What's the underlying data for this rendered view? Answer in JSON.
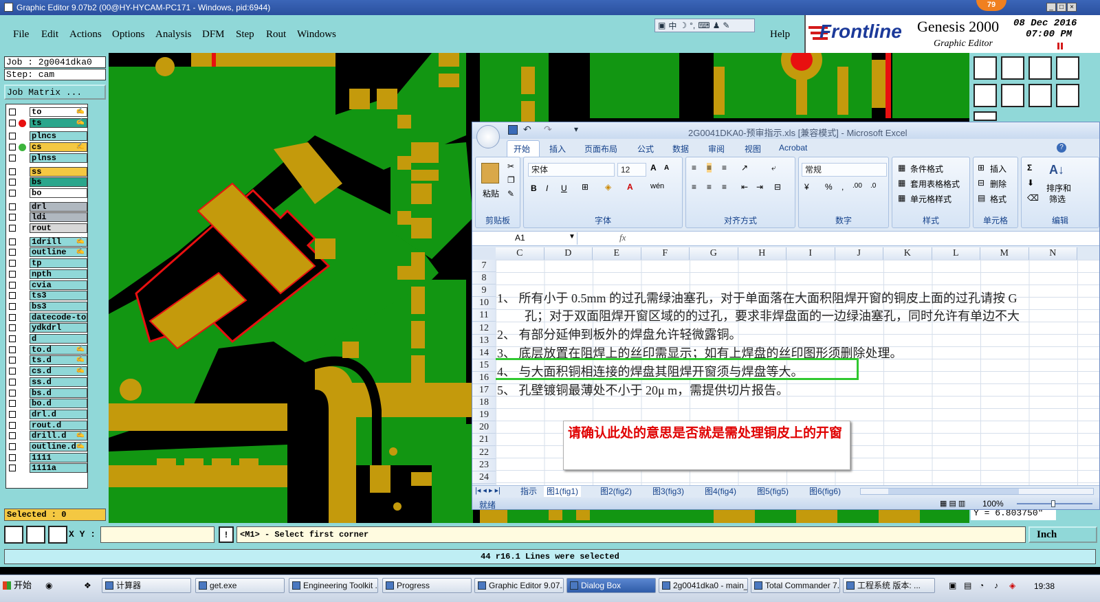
{
  "window": {
    "title": "Graphic Editor 9.07b2 (00@HY-HYCAM-PC171 - Windows, pid:6944)"
  },
  "menubar": {
    "items": [
      "File",
      "Edit",
      "Actions",
      "Options",
      "Analysis",
      "DFM",
      "Step",
      "Rout",
      "Windows"
    ],
    "help": "Help",
    "toolbar_icons": [
      "input-method-icon",
      "chinese-mode-icon",
      "moon-icon",
      "punctuation-icon",
      "keyboard-icon",
      "user-icon",
      "wrench-icon"
    ],
    "ime_label": "中"
  },
  "brand": {
    "logo": "Frontline",
    "product": "Genesis 2000",
    "subtitle": "Graphic Editor",
    "date": "08 Dec 2016",
    "time": "07:00 PM",
    "badge": "79"
  },
  "job": {
    "job": "Job : 2g0041dka0",
    "step": "Step: cam",
    "matrix_button": "Job Matrix ..."
  },
  "layers": [
    {
      "name": "to",
      "bg": "#ffffff",
      "dot": "",
      "mark": true
    },
    {
      "name": "ts",
      "bg": "#2aa68c",
      "dot": "#e81010",
      "mark": true
    },
    {
      "name": "plncs",
      "bg": "#90d8d8",
      "dot": "",
      "mark": false
    },
    {
      "name": "cs",
      "bg": "#f4c842",
      "dot": "#3cb43c",
      "mark": true
    },
    {
      "name": "plnss",
      "bg": "#90d8d8",
      "dot": "",
      "mark": false
    },
    {
      "name": "ss",
      "bg": "#f4c842",
      "dot": "",
      "mark": false
    },
    {
      "name": "bs",
      "bg": "#2aa68c",
      "dot": "",
      "mark": false
    },
    {
      "name": "bo",
      "bg": "#ffffff",
      "dot": "",
      "mark": false
    },
    {
      "name": "drl",
      "bg": "#b0b8c0",
      "dot": "",
      "mark": false
    },
    {
      "name": "ldi",
      "bg": "#b0b8c0",
      "dot": "",
      "mark": false
    },
    {
      "name": "rout",
      "bg": "#d8d8d8",
      "dot": "",
      "mark": false
    },
    {
      "name": "1drill",
      "bg": "#90d8d8",
      "dot": "",
      "mark": true
    },
    {
      "name": "outline",
      "bg": "#90d8d8",
      "dot": "",
      "mark": true
    },
    {
      "name": "tp",
      "bg": "#90d8d8",
      "dot": "",
      "mark": false
    },
    {
      "name": "npth",
      "bg": "#90d8d8",
      "dot": "",
      "mark": false
    },
    {
      "name": "cvia",
      "bg": "#90d8d8",
      "dot": "",
      "mark": false
    },
    {
      "name": "ts3",
      "bg": "#90d8d8",
      "dot": "",
      "mark": false
    },
    {
      "name": "bs3",
      "bg": "#90d8d8",
      "dot": "",
      "mark": false
    },
    {
      "name": "datecode-to",
      "bg": "#90d8d8",
      "dot": "",
      "mark": false
    },
    {
      "name": "ydkdrl",
      "bg": "#90d8d8",
      "dot": "",
      "mark": false
    },
    {
      "name": "d",
      "bg": "#90d8d8",
      "dot": "",
      "mark": false
    },
    {
      "name": "to.d",
      "bg": "#90d8d8",
      "dot": "",
      "mark": true
    },
    {
      "name": "ts.d",
      "bg": "#90d8d8",
      "dot": "",
      "mark": true
    },
    {
      "name": "cs.d",
      "bg": "#90d8d8",
      "dot": "",
      "mark": true
    },
    {
      "name": "ss.d",
      "bg": "#90d8d8",
      "dot": "",
      "mark": false
    },
    {
      "name": "bs.d",
      "bg": "#90d8d8",
      "dot": "",
      "mark": false
    },
    {
      "name": "bo.d",
      "bg": "#90d8d8",
      "dot": "",
      "mark": false
    },
    {
      "name": "drl.d",
      "bg": "#90d8d8",
      "dot": "",
      "mark": false
    },
    {
      "name": "rout.d",
      "bg": "#90d8d8",
      "dot": "",
      "mark": false
    },
    {
      "name": "drill.d",
      "bg": "#90d8d8",
      "dot": "",
      "mark": true
    },
    {
      "name": "outline.d",
      "bg": "#90d8d8",
      "dot": "",
      "mark": true
    },
    {
      "name": "1111",
      "bg": "#90d8d8",
      "dot": "",
      "mark": false
    },
    {
      "name": "1111a",
      "bg": "#90d8d8",
      "dot": "",
      "mark": false
    }
  ],
  "selected": "Selected : 0",
  "colors": {
    "board_green": "#129612",
    "copper": "#c49a0c",
    "mask_black": "#000000",
    "outline_red": "#e81010",
    "panel_cyan": "#90d8d8",
    "highlight_green": "#30c830"
  },
  "excel": {
    "title": "2G0041DKA0-预审指示.xls  [兼容模式] - Microsoft Excel",
    "tabs": [
      "开始",
      "插入",
      "页面布局",
      "公式",
      "数据",
      "审阅",
      "视图",
      "Acrobat"
    ],
    "font_name": "宋体",
    "font_size": "12",
    "number_format": "常规",
    "groups": [
      "剪贴板",
      "字体",
      "对齐方式",
      "数字",
      "样式",
      "单元格",
      "编辑"
    ],
    "paste": "粘贴",
    "style_buttons": [
      "条件格式",
      "套用表格格式",
      "单元格样式"
    ],
    "cell_buttons": [
      "插入",
      "删除",
      "格式"
    ],
    "edit_buttons": [
      "排序和",
      "筛选"
    ],
    "name_box": "A1",
    "fx": "fx",
    "columns": [
      "C",
      "D",
      "E",
      "F",
      "G",
      "H",
      "I",
      "J",
      "K",
      "L",
      "M",
      "N"
    ],
    "rows": [
      "7",
      "8",
      "9",
      "10",
      "11",
      "12",
      "13",
      "14",
      "15",
      "16",
      "17",
      "18",
      "19",
      "20",
      "21",
      "22",
      "23",
      "24"
    ],
    "lines": [
      "1、  所有小于 0.5mm 的过孔需绿油塞孔，对于单面落在大面积阻焊开窗的铜皮上面的过孔请按 G",
      "孔；对于双面阻焊开窗区域的的过孔，要求非焊盘面的一边绿油塞孔，同时允许有单边不大",
      "2、  有部分延伸到板外的焊盘允许轻微露铜。",
      "3、  底层放置在阻焊上的丝印需显示；如有上焊盘的丝印图形须删除处理。",
      "4、  与大面积铜相连接的焊盘其阻焊开窗须与焊盘等大。",
      "5、  孔壁镀铜最薄处不小于 20μ m，需提供切片报告。"
    ],
    "note": "请确认此处的意思是否就是需处理铜皮上的开窗",
    "sheets": [
      "指示",
      "图1(fig1)",
      "图2(fig2)",
      "图3(fig3)",
      "图4(fig4)",
      "图5(fig5)",
      "图6(fig6)"
    ],
    "status": "就绪",
    "zoom": "100%"
  },
  "coord_readout": "Y = 6.803750\"",
  "cmd": {
    "xy_label": "X Y :",
    "xy_value": "",
    "prompt": "<M1> - Select first corner",
    "units": "Inch"
  },
  "status_message": "44 r16.1 Lines were selected",
  "taskbar": {
    "start": "开始",
    "items": [
      "计算器",
      "get.exe",
      "Engineering Toolkit ...",
      "Progress",
      "Graphic Editor 9.07...",
      "Dialog Box",
      "2g0041dka0 - main_qa",
      "Total Commander 7...",
      "工程系统  版本: ..."
    ],
    "clock": "19:38"
  }
}
